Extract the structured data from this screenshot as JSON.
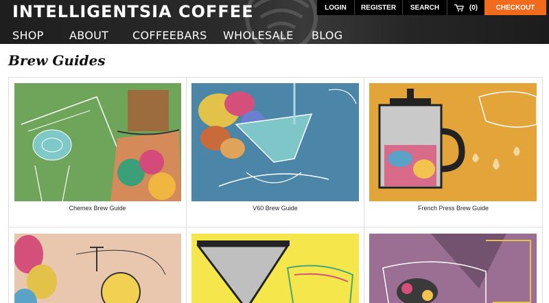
{
  "header": {
    "brand": "INTELLIGENTSIA COFFEE",
    "nav": [
      "SHOP",
      "ABOUT",
      "COFFEEBARS",
      "WHOLESALE",
      "BLOG"
    ],
    "top_links": {
      "login": "LOGIN",
      "register": "REGISTER",
      "search": "SEARCH",
      "cart_count": "(0)",
      "checkout": "CHECKOUT"
    },
    "icons": {
      "cart": "cart-icon",
      "emblem": "logo-emblem-icon"
    },
    "colors": {
      "header_bg": "#222222",
      "checkout_bg": "#f26b1d"
    }
  },
  "page": {
    "title": "Brew Guides"
  },
  "guides": [
    {
      "label": "Chemex Brew Guide",
      "bg": "#6fa55a"
    },
    {
      "label": "V60 Brew Guide",
      "bg": "#4b86a8"
    },
    {
      "label": "French Press Brew Guide",
      "bg": "#e3a43a"
    },
    {
      "label": "",
      "bg": "#e9c6ae"
    },
    {
      "label": "",
      "bg": "#f4e64b"
    },
    {
      "label": "",
      "bg": "#9a6f93"
    }
  ]
}
